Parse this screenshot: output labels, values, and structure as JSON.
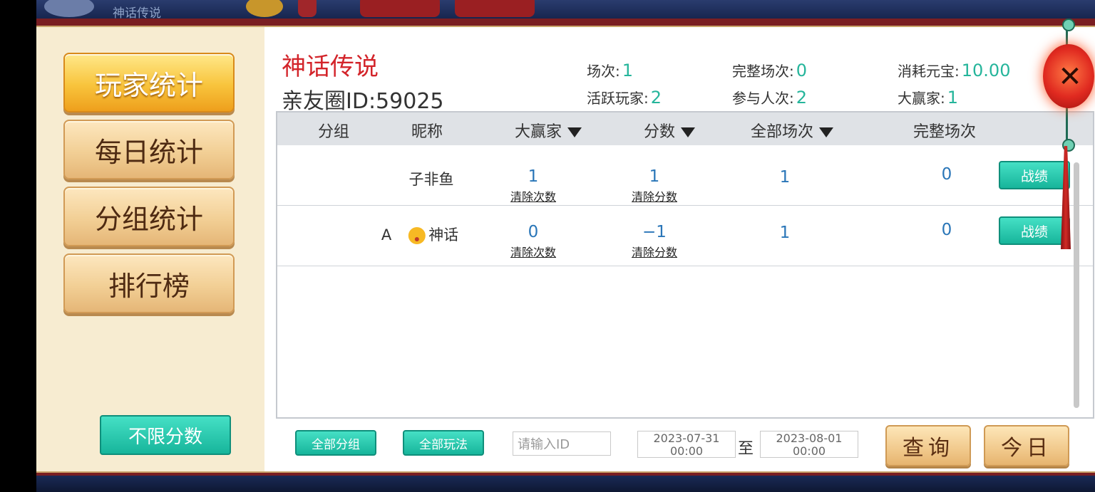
{
  "menu": {
    "player_stats": "玩家统计",
    "daily_stats": "每日统计",
    "group_stats": "分组统计",
    "leaderboard": "排行榜",
    "unlimited_score": "不限分数"
  },
  "header": {
    "title": "神话传说",
    "circle_id": "亲友圈ID:59025",
    "stats": {
      "games_label": "场次:",
      "games_value": "1",
      "complete_games_label": "完整场次:",
      "complete_games_value": "0",
      "consumed_label": "消耗元宝:",
      "consumed_value": "10.00",
      "active_players_label": "活跃玩家:",
      "active_players_value": "2",
      "participants_label": "参与人次:",
      "participants_value": "2",
      "big_winner_label": "大赢家:",
      "big_winner_value": "1"
    }
  },
  "table": {
    "columns": [
      "分组",
      "昵称",
      "大赢家",
      "分数",
      "全部场次",
      "完整场次"
    ],
    "clear_count_label": "清除次数",
    "clear_score_label": "清除分数",
    "record_button": "战绩",
    "rows": [
      {
        "group": "",
        "nickname": "子非鱼",
        "big_winner": "1",
        "score": "1",
        "all_games": "1",
        "complete_games": "0"
      },
      {
        "group": "",
        "nickname_prefix": "A",
        "nickname": "神话",
        "big_winner": "0",
        "score": "−1",
        "all_games": "1",
        "complete_games": "0"
      }
    ]
  },
  "footer": {
    "all_groups": "全部分组",
    "all_modes": "全部玩法",
    "id_placeholder": "请输入ID",
    "start_date": "2023-07-31",
    "start_time": "00:00",
    "to": "至",
    "end_date": "2023-08-01",
    "end_time": "00:00",
    "query": "查询",
    "today": "今日"
  },
  "background": {
    "top_text": "神话传说"
  },
  "colors": {
    "accent_green": "#25b59b",
    "title_red": "#d3242a",
    "number_blue": "#2a76b8",
    "panel_red": "#7a1e22"
  }
}
